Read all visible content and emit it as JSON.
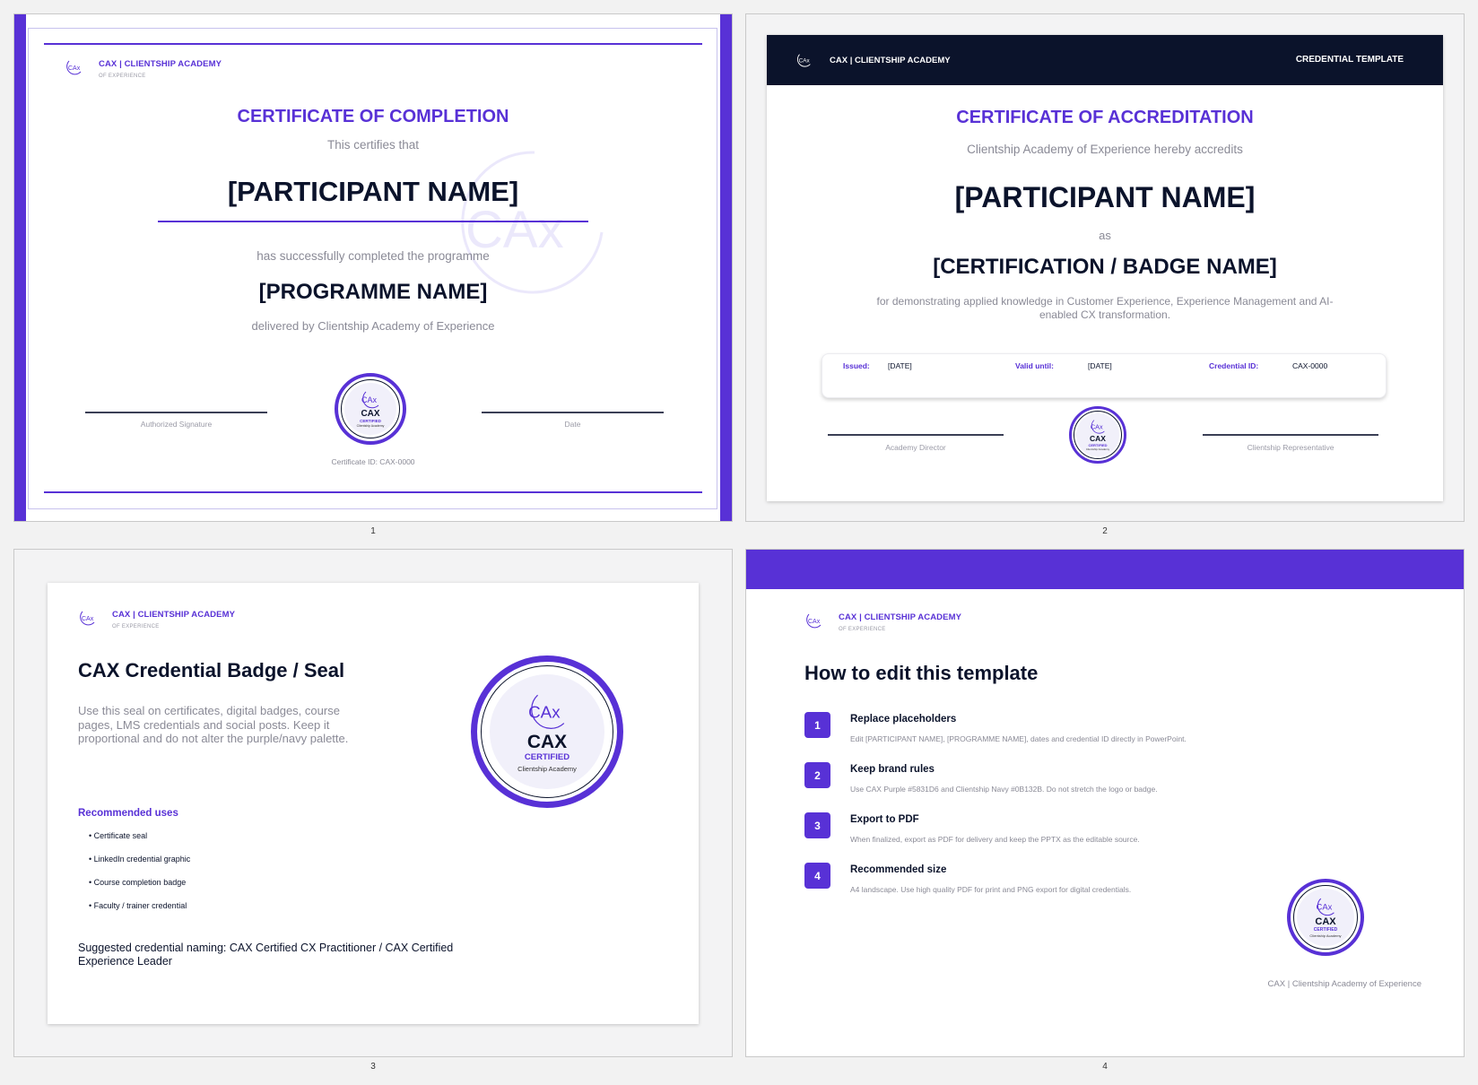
{
  "brand": {
    "title": "CAX | CLIENTSHIP ACADEMY",
    "subtitle": "OF EXPERIENCE",
    "colors": {
      "purple": "#5831d6",
      "navy": "#0b132b"
    },
    "logo_icon": "cax-logo-icon"
  },
  "seal": {
    "logo": "CAx",
    "name": "CAX",
    "certified": "CERTIFIED",
    "caption": "Clientship Academy"
  },
  "slide1": {
    "number": "1",
    "title": "CERTIFICATE OF COMPLETION",
    "certifies": "This certifies that",
    "participant": "[PARTICIPANT NAME]",
    "completed": "has successfully completed the programme",
    "programme": "[PROGRAMME NAME]",
    "delivered": "delivered by Clientship Academy of Experience",
    "sig_left": "Authorized Signature",
    "sig_right": "Date",
    "cert_id": "Certificate ID: CAX-0000",
    "watermark": "CAx"
  },
  "slide2": {
    "number": "2",
    "nav_title": "CAX | CLIENTSHIP ACADEMY",
    "nav_right": "CREDENTIAL TEMPLATE",
    "title": "CERTIFICATE OF ACCREDITATION",
    "accredits": "Clientship Academy of Experience hereby accredits",
    "participant": "[PARTICIPANT NAME]",
    "as": "as",
    "badge_name": "[CERTIFICATION / BADGE NAME]",
    "description_line1": "for demonstrating applied knowledge in Customer Experience, Experience Management and AI-",
    "description_line2": "enabled CX transformation.",
    "issued_label": "Issued:",
    "issued_value": "[DATE]",
    "valid_label": "Valid until:",
    "valid_value": "[DATE]",
    "credential_label": "Credential ID:",
    "credential_value": "CAX-0000",
    "sig_left": "Academy Director",
    "sig_right": "Clientship Representative"
  },
  "slide3": {
    "number": "3",
    "title": "CAX Credential Badge / Seal",
    "body_line1": "Use this seal on certificates, digital badges, course",
    "body_line2": "pages, LMS credentials and social posts. Keep it",
    "body_line3": "proportional and do not alter the purple/navy palette.",
    "uses_heading": "Recommended uses",
    "uses": [
      "• Certificate seal",
      "• LinkedIn credential graphic",
      "• Course completion badge",
      "• Faculty / trainer credential"
    ],
    "naming_line1": "Suggested credential naming: CAX Certified CX Practitioner / CAX Certified",
    "naming_line2": "Experience Leader"
  },
  "slide4": {
    "number": "4",
    "title": "How to edit this template",
    "steps": [
      {
        "num": "1",
        "title": "Replace placeholders",
        "desc": "Edit [PARTICIPANT NAME], [PROGRAMME NAME], dates and credential ID directly in PowerPoint."
      },
      {
        "num": "2",
        "title": "Keep brand rules",
        "desc": "Use CAX Purple #5831D6 and Clientship Navy #0B132B. Do not stretch the logo or badge."
      },
      {
        "num": "3",
        "title": "Export to PDF",
        "desc": "When finalized, export as PDF for delivery and keep the PPTX as the editable source."
      },
      {
        "num": "4",
        "title": "Recommended size",
        "desc": "A4 landscape. Use high quality PDF for print and PNG export for digital credentials."
      }
    ],
    "footer": "CAX | Clientship Academy of Experience"
  }
}
